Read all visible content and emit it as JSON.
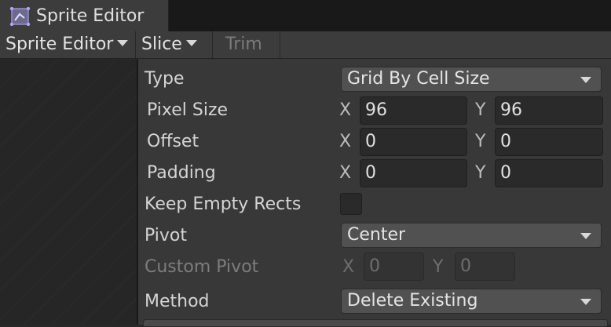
{
  "window": {
    "tab_title": "Sprite Editor",
    "tab_icon": "sprite-editor-icon"
  },
  "toolbar": {
    "mode_menu": "Sprite Editor",
    "slice_menu": "Slice",
    "trim_button": "Trim"
  },
  "slice_panel": {
    "type": {
      "label": "Type",
      "value": "Grid By Cell Size"
    },
    "pixel_size": {
      "label": "Pixel Size",
      "x_label": "X",
      "x": "96",
      "y_label": "Y",
      "y": "96"
    },
    "offset": {
      "label": "Offset",
      "x_label": "X",
      "x": "0",
      "y_label": "Y",
      "y": "0"
    },
    "padding": {
      "label": "Padding",
      "x_label": "X",
      "x": "0",
      "y_label": "Y",
      "y": "0"
    },
    "keep_empty_rects": {
      "label": "Keep Empty Rects",
      "checked": false
    },
    "pivot": {
      "label": "Pivot",
      "value": "Center"
    },
    "custom_pivot": {
      "label": "Custom Pivot",
      "x_label": "X",
      "x": "0",
      "y_label": "Y",
      "y": "0",
      "disabled": true
    },
    "method": {
      "label": "Method",
      "value": "Delete Existing"
    }
  }
}
